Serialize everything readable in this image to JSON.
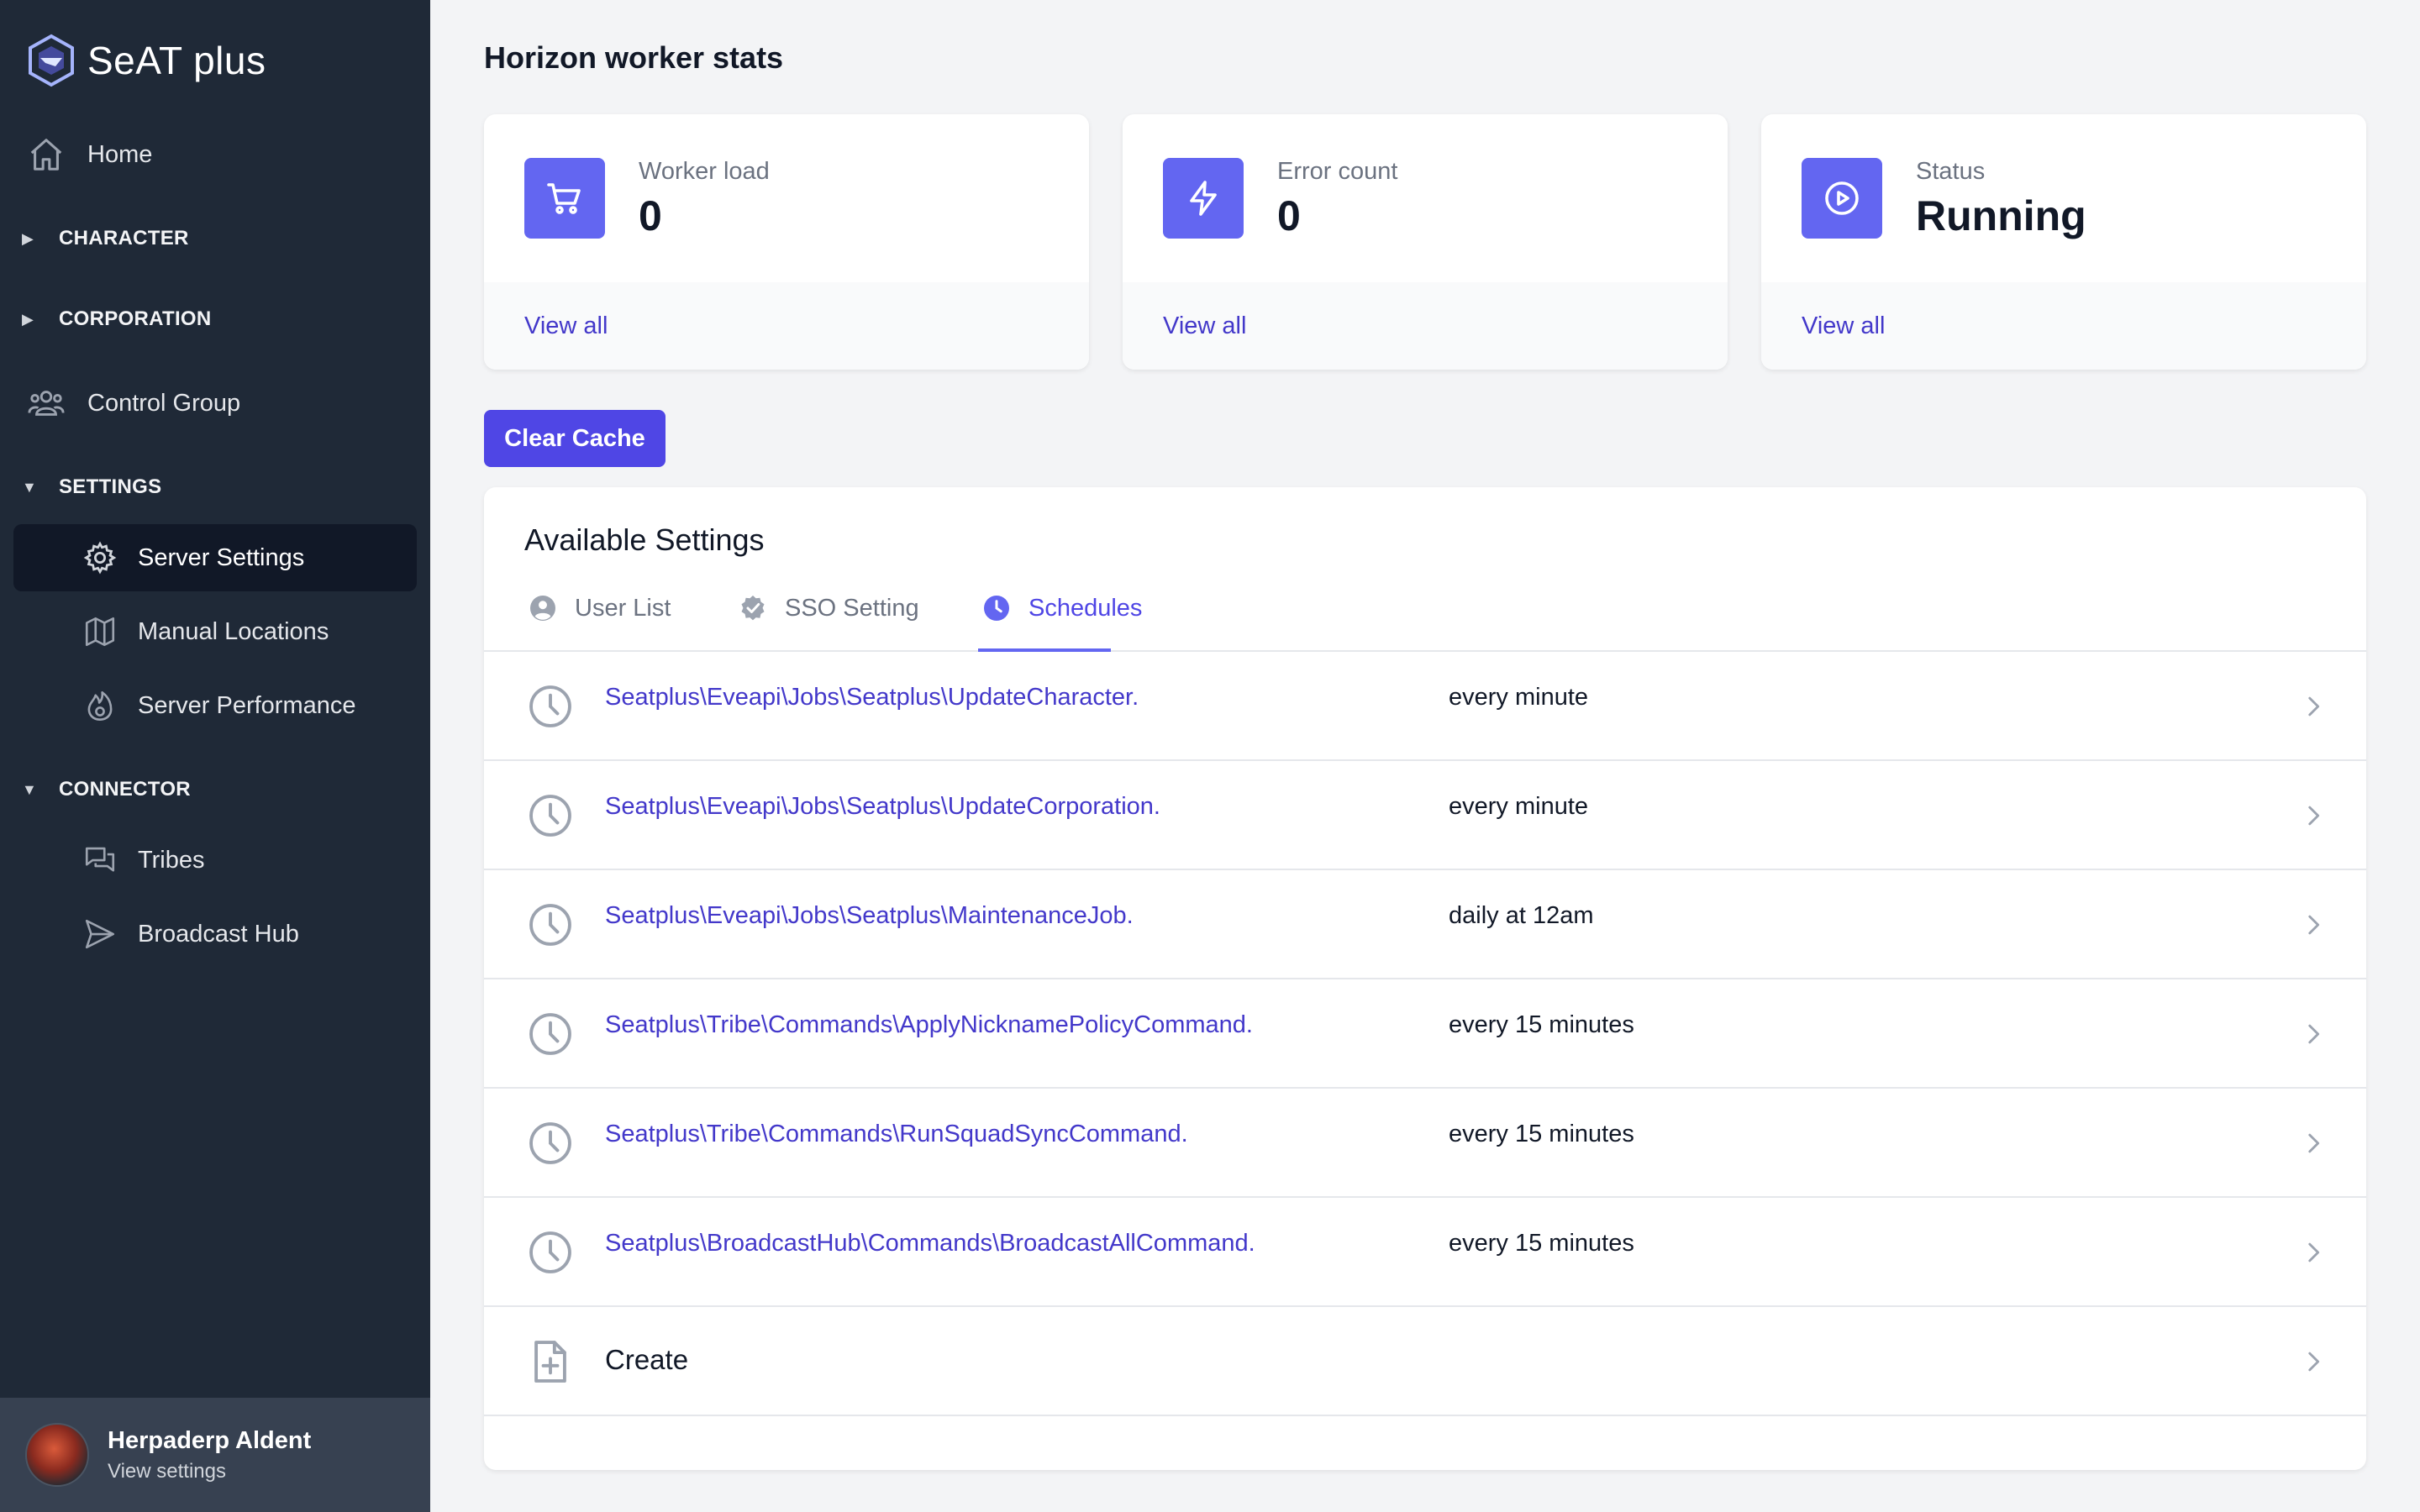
{
  "app": {
    "name": "SeAT plus"
  },
  "sidebar": {
    "home": "Home",
    "character": "CHARACTER",
    "corporation": "CORPORATION",
    "control_group": "Control Group",
    "settings": "SETTINGS",
    "settings_items": [
      "Server Settings",
      "Manual Locations",
      "Server Performance"
    ],
    "connector": "CONNECTOR",
    "connector_items": [
      "Tribes",
      "Broadcast Hub"
    ]
  },
  "profile": {
    "name": "Herpaderp Aldent",
    "link": "View settings"
  },
  "page": {
    "title": "Horizon worker stats"
  },
  "stats": [
    {
      "label": "Worker load",
      "value": "0",
      "link": "View all",
      "icon": "cart-icon"
    },
    {
      "label": "Error count",
      "value": "0",
      "link": "View all",
      "icon": "bolt-icon"
    },
    {
      "label": "Status",
      "value": "Running",
      "link": "View all",
      "icon": "play-circle-icon"
    }
  ],
  "actions": {
    "clear_cache": "Clear Cache"
  },
  "panel": {
    "title": "Available Settings",
    "tabs": [
      {
        "label": "User List",
        "icon": "user-circle-icon"
      },
      {
        "label": "SSO Setting",
        "icon": "badge-check-icon"
      },
      {
        "label": "Schedules",
        "icon": "clock-icon",
        "active": true
      }
    ],
    "schedules": [
      {
        "job": "Seatplus\\Eveapi\\Jobs\\Seatplus\\UpdateCharacter.",
        "frequency": "every minute"
      },
      {
        "job": "Seatplus\\Eveapi\\Jobs\\Seatplus\\UpdateCorporation.",
        "frequency": "every minute"
      },
      {
        "job": "Seatplus\\Eveapi\\Jobs\\Seatplus\\MaintenanceJob.",
        "frequency": "daily at 12am"
      },
      {
        "job": "Seatplus\\Tribe\\Commands\\ApplyNicknamePolicyCommand.",
        "frequency": "every 15 minutes"
      },
      {
        "job": "Seatplus\\Tribe\\Commands\\RunSquadSyncCommand.",
        "frequency": "every 15 minutes"
      },
      {
        "job": "Seatplus\\BroadcastHub\\Commands\\BroadcastAllCommand.",
        "frequency": "every 15 minutes"
      }
    ],
    "create": "Create"
  },
  "colors": {
    "sidebar_bg": "#1f2937",
    "accent": "#4f46e5",
    "accent_light": "#6366f1"
  }
}
